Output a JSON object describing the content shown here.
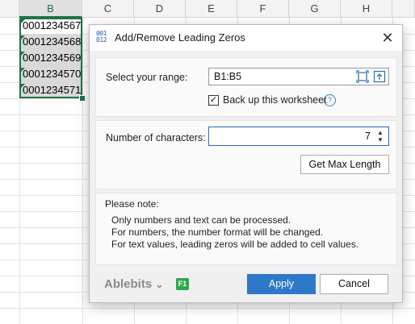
{
  "sheet": {
    "columns": [
      "B",
      "C",
      "D",
      "E",
      "F",
      "G",
      "H"
    ],
    "cells": [
      "0001234567",
      "0001234568",
      "0001234569",
      "0001234570",
      "0001234571"
    ]
  },
  "dialog": {
    "title": "Add/Remove Leading Zeros",
    "title_icon_top": "001",
    "title_icon_bottom": "012",
    "close": "✕",
    "range_label": "Select your range:",
    "range_value": "B1:B5",
    "backup_label": "Back up this worksheet",
    "backup_checked": "✓",
    "help": "?",
    "chars_label": "Number of characters:",
    "chars_value": "7",
    "spin_up": "▲",
    "spin_down": "▼",
    "max_button": "Get Max Length",
    "note_title": "Please note:",
    "notes": [
      "Only numbers and text can be processed.",
      "For numbers, the number format will be changed.",
      "For text values, leading zeros will be added to cell values."
    ],
    "brand": "Ablebits",
    "brand_chevron": "⌄",
    "f1": "F1",
    "apply": "Apply",
    "cancel": "Cancel"
  },
  "colors": {
    "excel_green": "#217346",
    "accent_blue": "#2d79c7",
    "f1_green": "#2ea84a"
  }
}
